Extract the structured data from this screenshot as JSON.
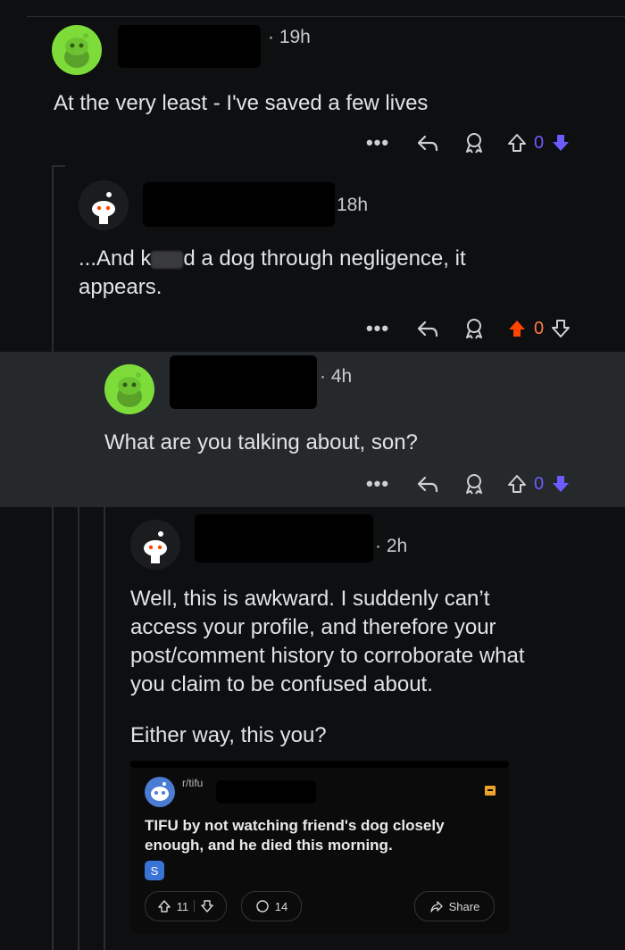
{
  "comments": [
    {
      "time": "· 19h",
      "text": "At the very least - I've saved a few lives",
      "vote_count": "0",
      "vote_state": "downvoted"
    },
    {
      "time": "18h",
      "text_line1": "...And k",
      "text_line1b": "d a dog through negligence, it",
      "text_line2": "appears.",
      "vote_count": "0",
      "vote_state": "upvoted"
    },
    {
      "time": "· 4h",
      "text": "What are you talking about, son?",
      "vote_count": "0",
      "vote_state": "downvoted"
    },
    {
      "time": "· 2h",
      "paragraph1": [
        "Well, this is awkward. I suddenly can’t",
        "access your profile, and therefore your",
        "post/comment history to corroborate what",
        "you claim to be confused about."
      ],
      "paragraph2": "Either way, this you?"
    }
  ],
  "embedded_post": {
    "subreddit": "r/tifu",
    "title_line1": "TIFU by not watching friend's dog closely",
    "title_line2": "enough, and he died this morning.",
    "flair": "S",
    "upvotes": "11",
    "comments": "14",
    "share_label": "Share"
  },
  "colors": {
    "upvote": "#ff4500",
    "downvote": "#6a5cff",
    "highlight_bg": "#26292c",
    "avatar_green": "#7ddc3a",
    "avatar_dark": "#1b1c1e"
  }
}
